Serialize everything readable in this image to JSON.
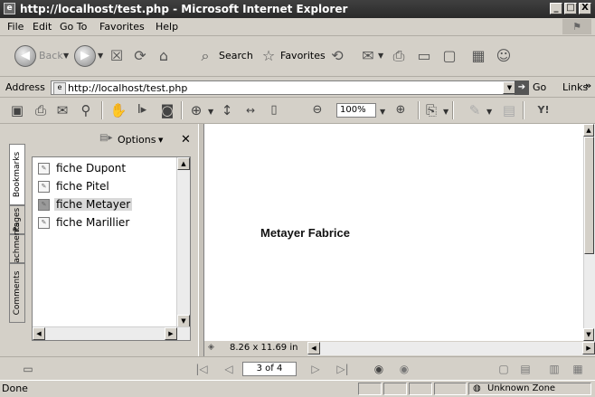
{
  "window": {
    "title": "http://localhost/test.php - Microsoft Internet Explorer",
    "minimize": "_",
    "maximize": "□",
    "close": "X"
  },
  "menu": [
    "File",
    "Edit",
    "Go To",
    "Favorites",
    "Help"
  ],
  "toolbar": {
    "back_label": "Back",
    "search_label": "Search",
    "favorites_label": "Favorites"
  },
  "address": {
    "label": "Address",
    "url": "http://localhost/test.php",
    "go_label": "Go",
    "links_label": "Links",
    "links_more": "»"
  },
  "pdf_toolbar": {
    "zoom_value": "100%"
  },
  "side_tabs": [
    "Bookmarks",
    "Pages",
    "Attachments",
    "Comments"
  ],
  "bookmarks": {
    "options_label": "Options",
    "close_label": "✕",
    "items": [
      {
        "label": "fiche Dupont",
        "selected": false
      },
      {
        "label": "fiche Pitel",
        "selected": false
      },
      {
        "label": "fiche Metayer",
        "selected": true
      },
      {
        "label": "fiche Marillier",
        "selected": false
      }
    ]
  },
  "document": {
    "text": "Metayer Fabrice",
    "page_size": "8.26 x 11.69 in"
  },
  "navigation": {
    "page_indicator": "3 of 4"
  },
  "status": {
    "left": "Done",
    "zone": "Unknown Zone"
  }
}
